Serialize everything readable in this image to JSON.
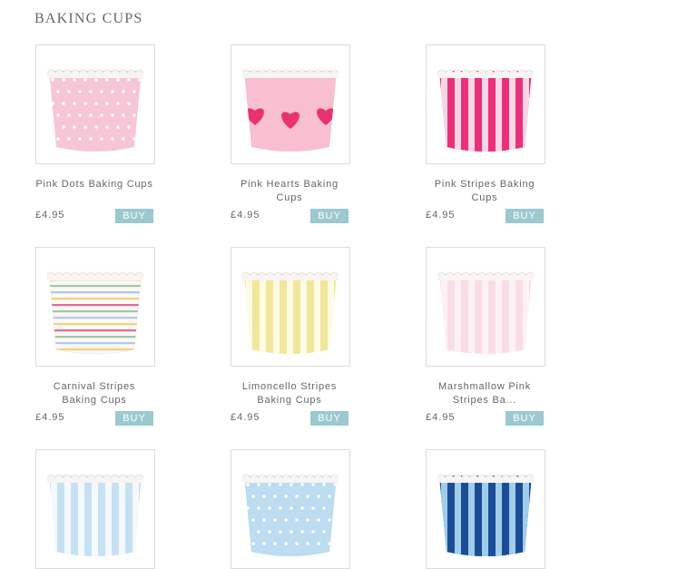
{
  "page": {
    "title": "BAKING CUPS"
  },
  "products": [
    {
      "name": "Pink Dots Baking Cups",
      "price": "£4.95",
      "buy_label": "BUY",
      "pattern": "dots",
      "colors": [
        "#f7c6d6",
        "#ffffff"
      ]
    },
    {
      "name": "Pink Hearts Baking Cups",
      "price": "£4.95",
      "buy_label": "BUY",
      "pattern": "hearts",
      "colors": [
        "#f7bfd0",
        "#e8336f"
      ]
    },
    {
      "name": "Pink Stripes Baking Cups",
      "price": "£4.95",
      "buy_label": "BUY",
      "pattern": "stripes",
      "colors": [
        "#e83179",
        "#fbd5e4"
      ]
    },
    {
      "name": "Carnival Stripes Baking Cups",
      "price": "£4.95",
      "buy_label": "BUY",
      "pattern": "hstripes",
      "colors": [
        "#e8669a",
        "#9fc8a6",
        "#b3c6ea",
        "#f2d27a"
      ]
    },
    {
      "name": "Limoncello Stripes Baking Cups",
      "price": "£4.95",
      "buy_label": "BUY",
      "pattern": "stripes",
      "colors": [
        "#f1e69c",
        "#fefbe3"
      ]
    },
    {
      "name": "Marshmallow Pink Stripes Ba...",
      "price": "£4.95",
      "buy_label": "BUY",
      "pattern": "stripes",
      "colors": [
        "#f9dde6",
        "#fdf1f5"
      ]
    },
    {
      "name": "",
      "price": "",
      "buy_label": "",
      "pattern": "stripes",
      "colors": [
        "#c6e1f1",
        "#f3f9fd"
      ]
    },
    {
      "name": "",
      "price": "",
      "buy_label": "",
      "pattern": "dots",
      "colors": [
        "#bcdcef",
        "#ffffff"
      ]
    },
    {
      "name": "",
      "price": "",
      "buy_label": "",
      "pattern": "stripes",
      "colors": [
        "#1b4d96",
        "#9fcdea"
      ]
    }
  ]
}
